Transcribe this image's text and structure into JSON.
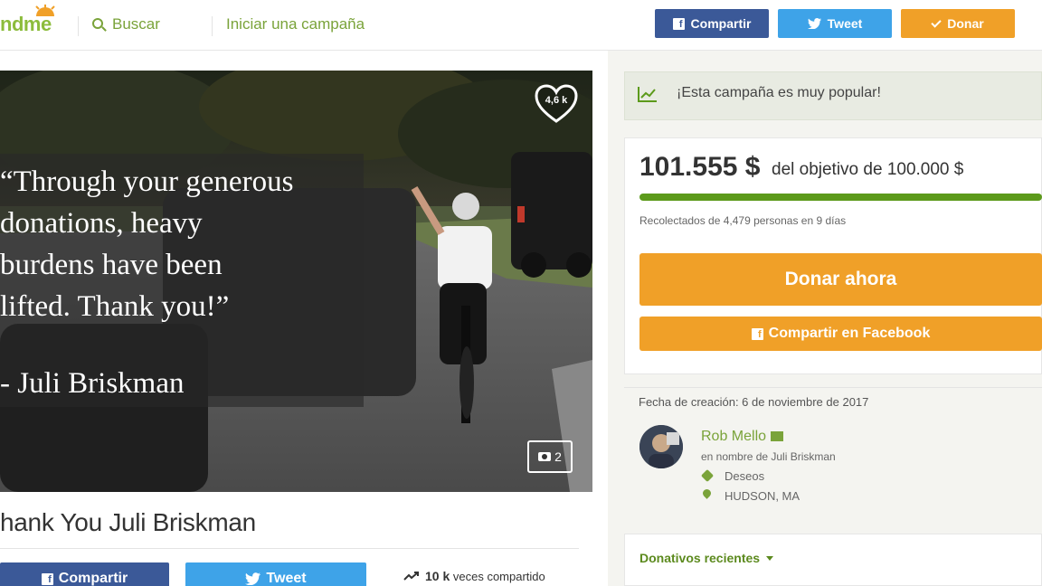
{
  "header": {
    "logo_text": "ndme",
    "search_label": "Buscar",
    "start_campaign_label": "Iniciar una campaña",
    "share_label": "Compartir",
    "tweet_label": "Tweet",
    "donate_label": "Donar"
  },
  "photo": {
    "quote_lines": [
      "“Through your generous",
      "donations, heavy",
      "burdens have been",
      "lifted.  Thank you!”"
    ],
    "quote_author": "- Juli Briskman",
    "hearts_count": "4,6 k",
    "photos_count": "2"
  },
  "campaign": {
    "title": "hank You Juli Briskman",
    "share_button": "Compartir",
    "tweet_button": "Tweet",
    "shares_count": "10 k",
    "shares_label": "veces compartido"
  },
  "sidebar": {
    "popular_text": "¡Esta campaña es muy popular!",
    "amount_raised": "101.555 $",
    "goal_text": "del objetivo de 100.000 $",
    "progress_fraction": 1.0,
    "raised_summary": "Recolectados de 4,479 personas en 9 días",
    "donate_now": "Donar ahora",
    "share_facebook": "Compartir en Facebook",
    "created_date": "Fecha de creación: 6 de noviembre de 2017",
    "organizer_name": "Rob Mello",
    "on_behalf": "en nombre de Juli Briskman",
    "category": "Deseos",
    "location": "HUDSON, MA",
    "recent_donations": "Donativos recientes"
  },
  "colors": {
    "brand_green": "#7aa33a",
    "facebook": "#3b5998",
    "twitter": "#3ea3e8",
    "donate_orange": "#f0a028",
    "progress_green": "#5c9a1b"
  },
  "icons": [
    "search-icon",
    "facebook-icon",
    "twitter-icon",
    "check-icon",
    "heart-icon",
    "camera-icon",
    "trend-icon",
    "chart-icon",
    "mail-icon",
    "tag-icon",
    "pin-icon",
    "caret-down-icon"
  ]
}
